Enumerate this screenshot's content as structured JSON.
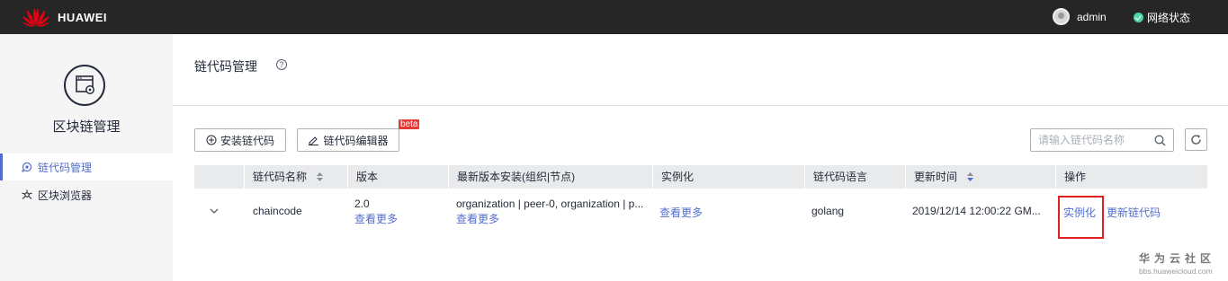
{
  "header": {
    "brand": "HUAWEI",
    "user": "admin",
    "network_status": "网络状态",
    "colors": {
      "bar": "#262626",
      "status_ok": "#50d4ab"
    }
  },
  "sidebar": {
    "title": "区块链管理",
    "items": [
      {
        "label": "链代码管理",
        "icon": "chaincode-icon",
        "active": true
      },
      {
        "label": "区块浏览器",
        "icon": "block-explorer-icon",
        "active": false
      }
    ],
    "accent": "#526ecc"
  },
  "main": {
    "title": "链代码管理",
    "toolbar": {
      "install_label": "安装链代码",
      "editor_label": "链代码编辑器",
      "beta_badge": "beta",
      "search_placeholder": "请输入链代码名称"
    },
    "table": {
      "columns": [
        "链代码名称",
        "版本",
        "最新版本安装(组织|节点)",
        "实例化",
        "链代码语言",
        "更新时间",
        "操作"
      ],
      "rows": [
        {
          "name": "chaincode",
          "version": "2.0",
          "version_more": "查看更多",
          "install": "organization | peer-0, organization | p...",
          "install_more": "查看更多",
          "instantiate_more": "查看更多",
          "language": "golang",
          "updated": "2019/12/14 12:00:22 GM...",
          "actions": [
            "实例化",
            "更新链代码"
          ]
        }
      ]
    }
  },
  "watermark": {
    "cn": "华为云社区",
    "en": "bbs.huaweicloud.com"
  }
}
